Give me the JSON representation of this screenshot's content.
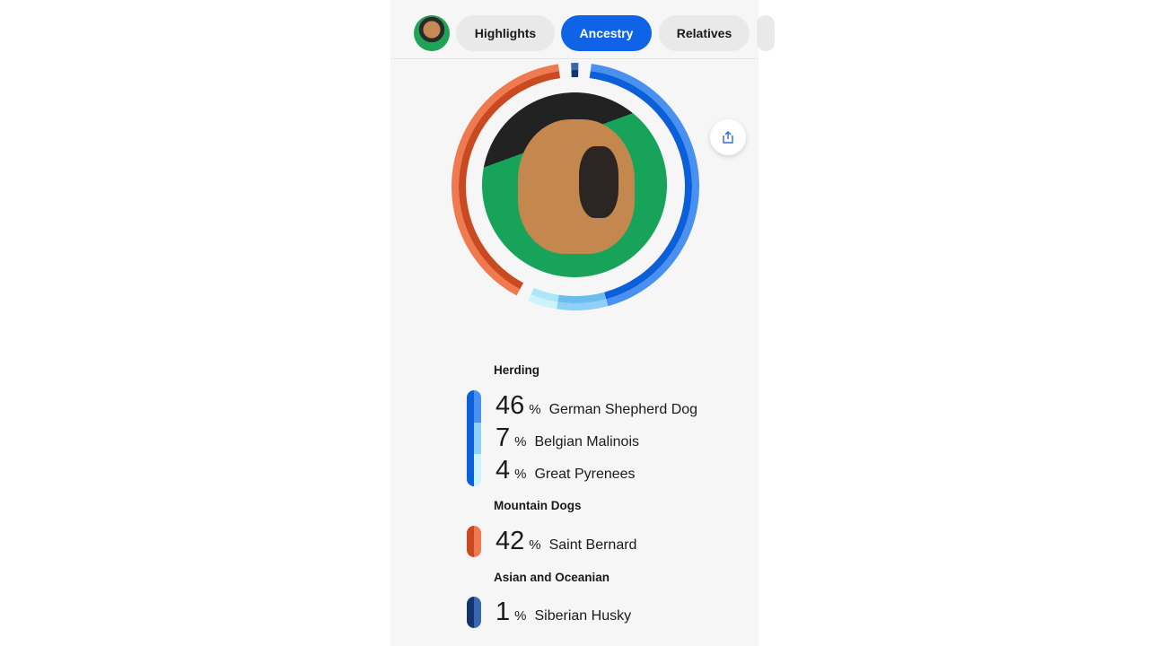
{
  "tabs": [
    {
      "label": "Highlights",
      "active": false
    },
    {
      "label": "Ancestry",
      "active": true
    },
    {
      "label": "Relatives",
      "active": false
    }
  ],
  "share_icon": "share-icon",
  "groups": [
    {
      "title": "Herding",
      "breeds": [
        {
          "pct": "46",
          "sign": "%",
          "name": "German Shepherd Dog",
          "value": 46,
          "color": "#4a90f0",
          "dark": "#0b5fd8"
        },
        {
          "pct": "7",
          "sign": "%",
          "name": "Belgian Malinois",
          "value": 7,
          "color": "#8fd0f6",
          "dark": "#6cbcf0"
        },
        {
          "pct": "4",
          "sign": "%",
          "name": "Great Pyrenees",
          "value": 4,
          "color": "#cdf3fa",
          "dark": "#aee6f5"
        }
      ]
    },
    {
      "title": "Mountain Dogs",
      "breeds": [
        {
          "pct": "42",
          "sign": "%",
          "name": "Saint Bernard",
          "value": 42,
          "color": "#f07a50",
          "dark": "#c94a20"
        }
      ]
    },
    {
      "title": "Asian and Oceanian",
      "breeds": [
        {
          "pct": "1",
          "sign": "%",
          "name": "Siberian Husky",
          "value": 1,
          "color": "#3a68b0",
          "dark": "#15336e"
        }
      ]
    }
  ]
}
